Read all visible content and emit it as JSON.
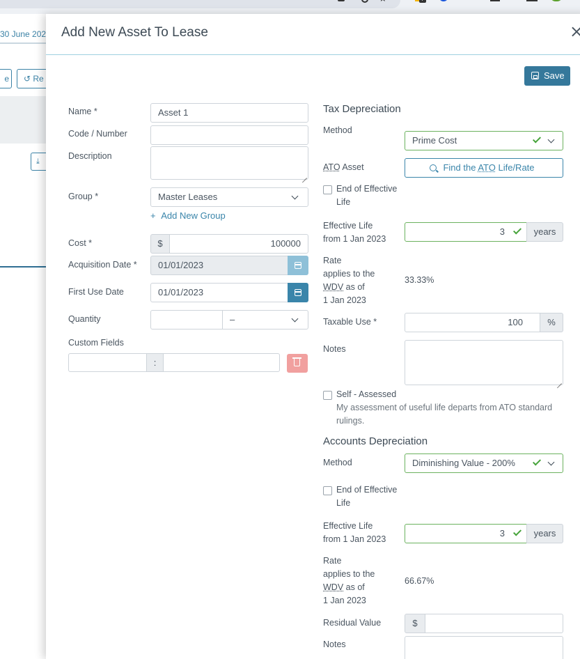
{
  "background": {
    "date_text": "30 June 202",
    "btn1_text": "e",
    "btn2_text": "Re"
  },
  "modal": {
    "title": "Add New Asset To Lease",
    "save_label": "Save"
  },
  "left": {
    "name_label": "Name *",
    "name_value": "Asset 1",
    "code_label": "Code / Number",
    "code_value": "",
    "description_label": "Description",
    "group_label": "Group *",
    "group_value": "Master Leases",
    "add_group_label": "Add New Group",
    "cost_label": "Cost *",
    "cost_currency": "$",
    "cost_value": "100000",
    "acq_label": "Acquisition Date *",
    "acq_value": "01/01/2023",
    "first_use_label": "First Use Date",
    "first_use_value": "01/01/2023",
    "quantity_label": "Quantity",
    "quantity_value": "",
    "quantity_unit": "–",
    "custom_label": "Custom Fields",
    "custom_sep": ":"
  },
  "tax": {
    "title": "Tax Depreciation",
    "method_label": "Method",
    "method_value": "Prime Cost",
    "ato_label_abbr": "ATO",
    "ato_label_rest": " Asset",
    "find_pre": "Find the ",
    "find_abbr": "ATO",
    "find_post": " Life/Rate",
    "end_life_line1": "End of Effective",
    "end_life_line2": "Life",
    "eff_life_line1": "Effective Life",
    "eff_life_line2": "from 1 Jan 2023",
    "eff_life_value": "3",
    "years": "years",
    "rate_line1": "Rate",
    "rate_line2": "applies to the",
    "rate_abbr": "WDV",
    "rate_line3_rest": " as of",
    "rate_line4": "1 Jan 2023",
    "rate_value": "33.33%",
    "taxable_label": "Taxable Use *",
    "taxable_value": "100",
    "percent": "%",
    "notes_label": "Notes",
    "self_label": "Self - Assessed",
    "self_desc_line1": "My assessment of useful life departs from ATO standard",
    "self_desc_line2": "rulings."
  },
  "accounts": {
    "title": "Accounts Depreciation",
    "method_label": "Method",
    "method_value": "Diminishing Value - 200%",
    "end_life_line1": "End of Effective",
    "end_life_line2": "Life",
    "eff_life_line1": "Effective Life",
    "eff_life_line2": "from 1 Jan 2023",
    "eff_life_value": "3",
    "years": "years",
    "rate_line1": "Rate",
    "rate_line2": "applies to the",
    "rate_abbr": "WDV",
    "rate_line3_rest": " as of",
    "rate_line4": "1 Jan 2023",
    "rate_value": "66.67%",
    "residual_label": "Residual Value",
    "residual_currency": "$",
    "residual_value": "",
    "notes_label": "Notes"
  },
  "colors": {
    "accent": "#35789b",
    "success": "#46a33a",
    "danger_light": "#f1a09f"
  }
}
